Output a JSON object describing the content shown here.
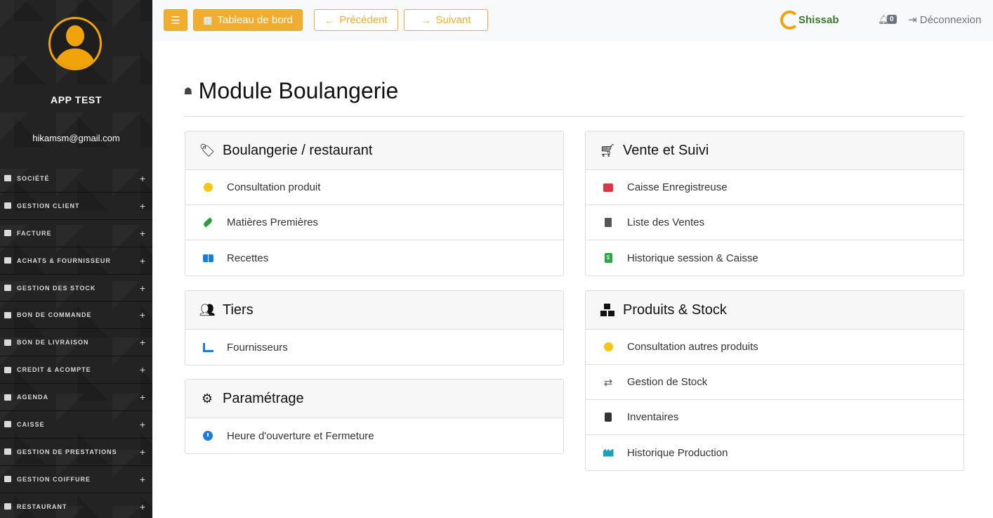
{
  "sidebar": {
    "app_name": "APP TEST",
    "email": "hikamsm@gmail.com",
    "items": [
      {
        "label": "SOCIÉTÉ",
        "icon": "building-icon"
      },
      {
        "label": "GESTION CLIENT",
        "icon": "id-card-icon"
      },
      {
        "label": "FACTURE",
        "icon": "file-icon"
      },
      {
        "label": "ACHATS & FOURNISSEUR",
        "icon": "store-icon"
      },
      {
        "label": "GESTION DES STOCK",
        "icon": "database-icon"
      },
      {
        "label": "BON DE COMMANDE",
        "icon": "file-icon"
      },
      {
        "label": "BON DE LIVRAISON",
        "icon": "truck-icon"
      },
      {
        "label": "CREDIT & ACOMPTE",
        "icon": "credit-card-icon"
      },
      {
        "label": "AGENDA",
        "icon": "calendar-icon"
      },
      {
        "label": "CAISSE",
        "icon": "bank-icon"
      },
      {
        "label": "GESTION DE PRESTATIONS",
        "icon": "layers-icon"
      },
      {
        "label": "GESTION COIFFURE",
        "icon": "spa-icon"
      },
      {
        "label": "RESTAURANT",
        "icon": "utensils-icon"
      }
    ],
    "expand_symbol": "+"
  },
  "topbar": {
    "menu_toggle_icon": "bars-icon",
    "dashboard_label": "Tableau de bord",
    "previous_label": "Précédent",
    "next_label": "Suivant",
    "logo_text": "Shissab",
    "notifications_count": "0",
    "logout_label": "Déconnexion"
  },
  "page": {
    "title": "Module Boulangerie",
    "title_icon": "bread-icon"
  },
  "cards": {
    "boulangerie": {
      "title": "Boulangerie / restaurant",
      "items": [
        "Consultation produit",
        "Matières Premières",
        "Recettes"
      ]
    },
    "tiers": {
      "title": "Tiers",
      "items": [
        "Fournisseurs"
      ]
    },
    "parametrage": {
      "title": "Paramétrage",
      "items": [
        "Heure d'ouverture et Fermeture"
      ]
    },
    "vente": {
      "title": "Vente et Suivi",
      "items": [
        "Caisse Enregistreuse",
        "Liste des Ventes",
        "Historique session & Caisse"
      ]
    },
    "produits": {
      "title": "Produits & Stock",
      "items": [
        "Consultation autres produits",
        "Gestion de Stock",
        "Inventaires",
        "Historique Production"
      ]
    }
  },
  "colors": {
    "accent": "#f0ad2f",
    "sidebar_bg": "#232323",
    "avatar": "#f0a30a"
  }
}
